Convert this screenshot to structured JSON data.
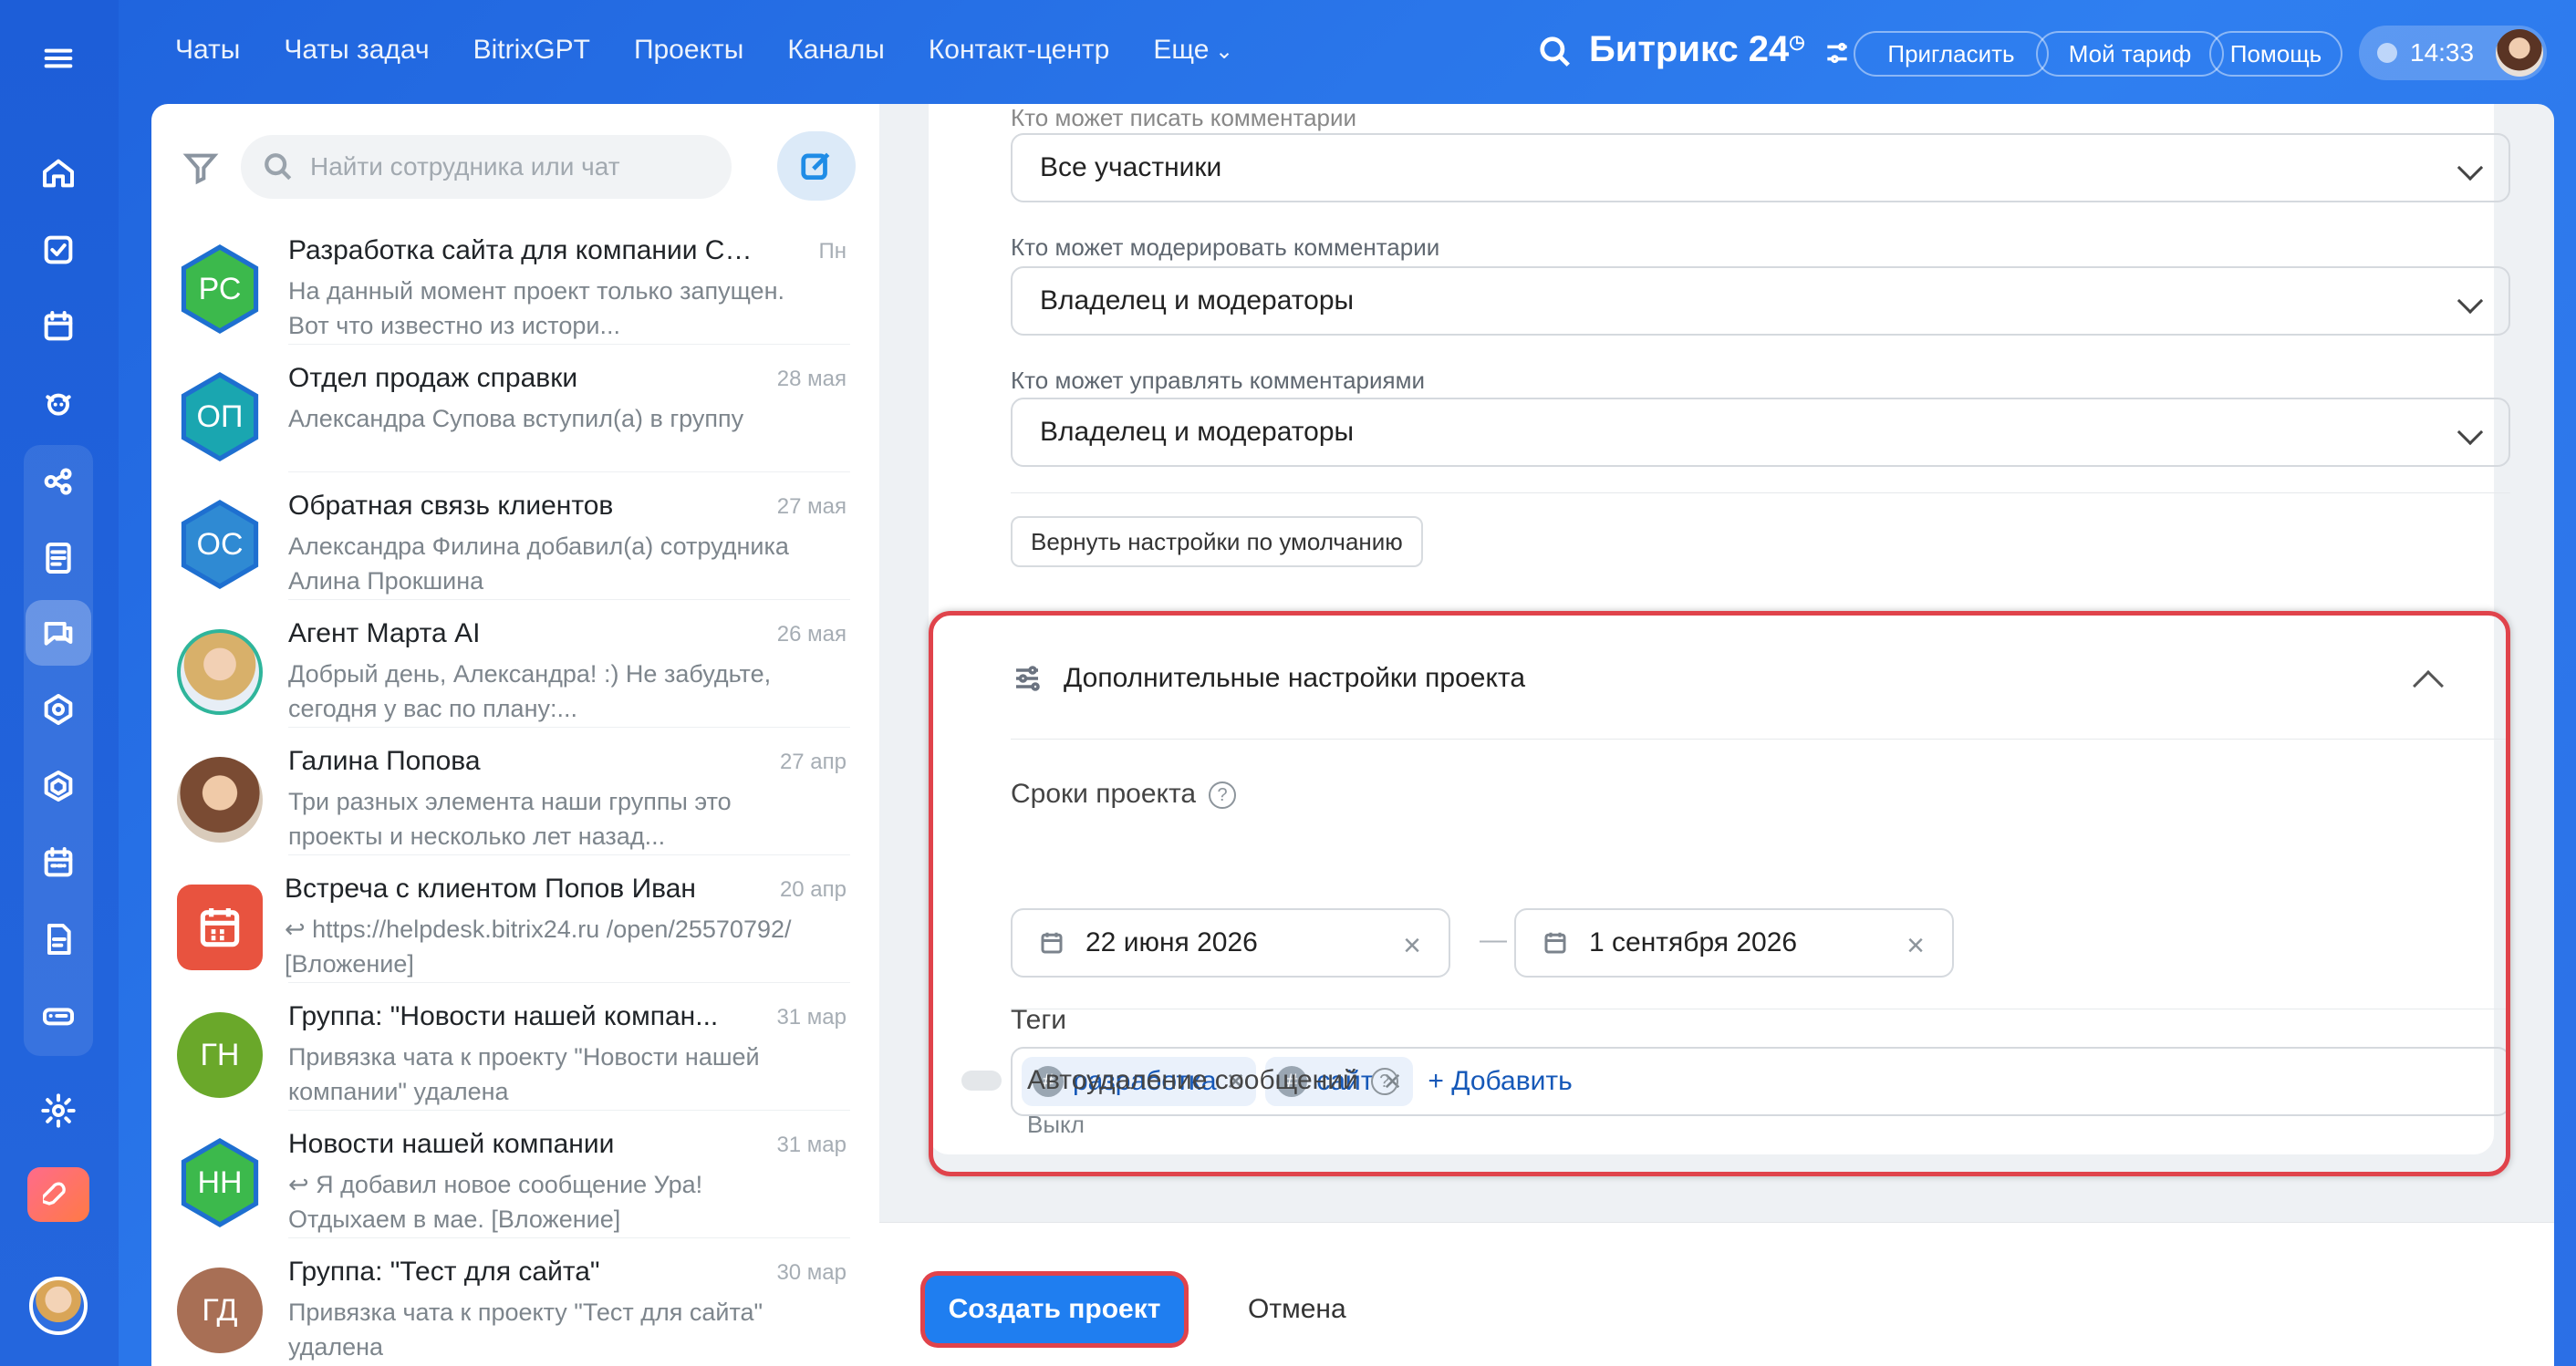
{
  "topnav": {
    "items": [
      "Чаты",
      "Чаты задач",
      "BitrixGPT",
      "Проекты",
      "Каналы",
      "Контакт-центр",
      "Еще"
    ],
    "brand": "Битрикс 24",
    "invite": "Пригласить",
    "tariff": "Мой тариф",
    "help": "Помощь",
    "time": "14:33"
  },
  "chatlist": {
    "search_placeholder": "Найти сотрудника или чат",
    "items": [
      {
        "title": "Разработка сайта для компании Сф...",
        "date": "Пн",
        "preview": "На данный момент проект только запущен. Вот что известно из истори...",
        "initials": "РС",
        "color": "#3cb94c"
      },
      {
        "title": "Отдел продаж справки",
        "date": "28 мая",
        "preview": "Александра Супова вступил(а) в группу",
        "initials": "ОП",
        "color": "#1aa6b0"
      },
      {
        "title": "Обратная связь клиентов",
        "date": "27 мая",
        "preview": "Александра Филина добавил(а) сотрудника Алина Прокшина",
        "initials": "ОС",
        "color": "#2f8ad3"
      },
      {
        "title": "Агент Марта AI",
        "date": "26 мая",
        "preview": "Добрый день, Александра! :) Не забудьте, сегодня у вас по плану:...",
        "initials": "",
        "color": "#d9b884"
      },
      {
        "title": "Галина Попова",
        "date": "27 апр",
        "preview": "Три разных элемента наши группы это проекты и несколько лет назад...",
        "initials": "",
        "color": "#b58a6a"
      },
      {
        "title": "Встреча с клиентом Попов Иван",
        "date": "20 апр",
        "preview": "↩ https://helpdesk.bitrix24.ru /open/25570792/ [Вложение]",
        "initials": "",
        "color": "#e8533f"
      },
      {
        "title": "Группа: \"Новости нашей компан...",
        "date": "31 мар",
        "preview": "Привязка чата к проекту \"Новости нашей компании\" удалена",
        "initials": "ГН",
        "color": "#6aa82a"
      },
      {
        "title": "Новости нашей компании",
        "date": "31 мар",
        "preview": "↩ Я добавил новое сообщение Ура! Отдыхаем в мае. [Вложение]",
        "initials": "НН",
        "color": "#3cb94c"
      },
      {
        "title": "Группа: \"Тест для сайта\"",
        "date": "30 мар",
        "preview": "Привязка чата к проекту \"Тест для сайта\" удалена",
        "initials": "ГД",
        "color": "#a86f55"
      }
    ]
  },
  "settings": {
    "comments_partial_label": "Кто может писать комментарии",
    "comments_write_value": "Все участники",
    "moderate_label": "Кто может модерировать комментарии",
    "moderate_value": "Владелец и модераторы",
    "manage_label": "Кто может управлять комментариями",
    "manage_value": "Владелец и модераторы",
    "reset_button": "Вернуть настройки по умолчанию"
  },
  "advanced": {
    "title": "Дополнительные настройки проекта",
    "terms_label": "Сроки проекта",
    "start_date": "22 июня 2026",
    "end_date": "1 сентября 2026",
    "tags_label": "Теги",
    "tags": [
      "разработка",
      "сайт"
    ],
    "add_tag": "+ Добавить",
    "autodelete_label": "Автоудаление сообщений",
    "autodelete_value": "Выкл"
  },
  "footer": {
    "create_button": "Создать проект",
    "cancel_button": "Отмена"
  }
}
